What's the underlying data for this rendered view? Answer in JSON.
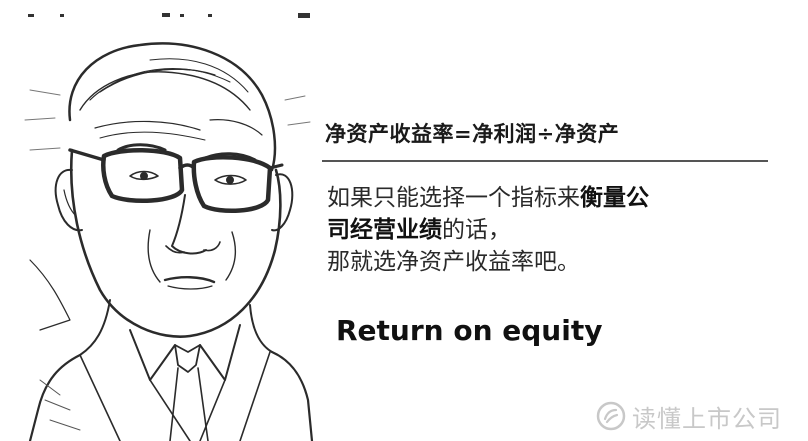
{
  "formula": "净资产收益率=净利润÷净资产",
  "quote": {
    "line1_a": "如果只能选择一个指标来",
    "line1_b": "衡量公",
    "line2_a": "司经营业绩",
    "line2_b": "的话，",
    "line3": "那就选净资产收益率吧。"
  },
  "english_caption": "Return on equity",
  "watermark": "读懂上市公司",
  "portrait_icon": "man-with-glasses-sketch"
}
